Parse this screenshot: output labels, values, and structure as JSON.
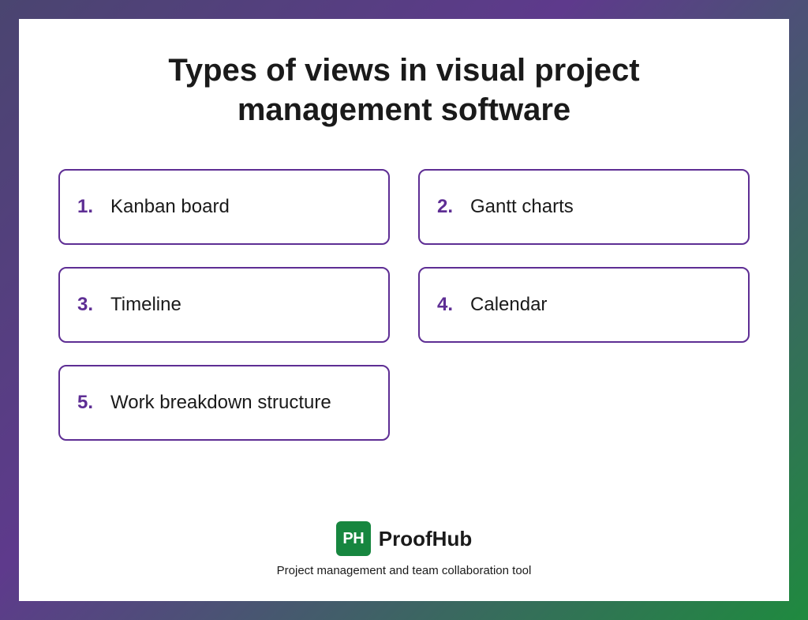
{
  "title": "Types of views in visual project management software",
  "items": [
    {
      "num": "1.",
      "label": "Kanban board"
    },
    {
      "num": "2.",
      "label": "Gantt charts"
    },
    {
      "num": "3.",
      "label": "Timeline"
    },
    {
      "num": "4.",
      "label": "Calendar"
    },
    {
      "num": "5.",
      "label": "Work breakdown structure"
    }
  ],
  "brand": {
    "logo_text": "PH",
    "name": "ProofHub",
    "tagline": "Project management and team collaboration tool"
  }
}
